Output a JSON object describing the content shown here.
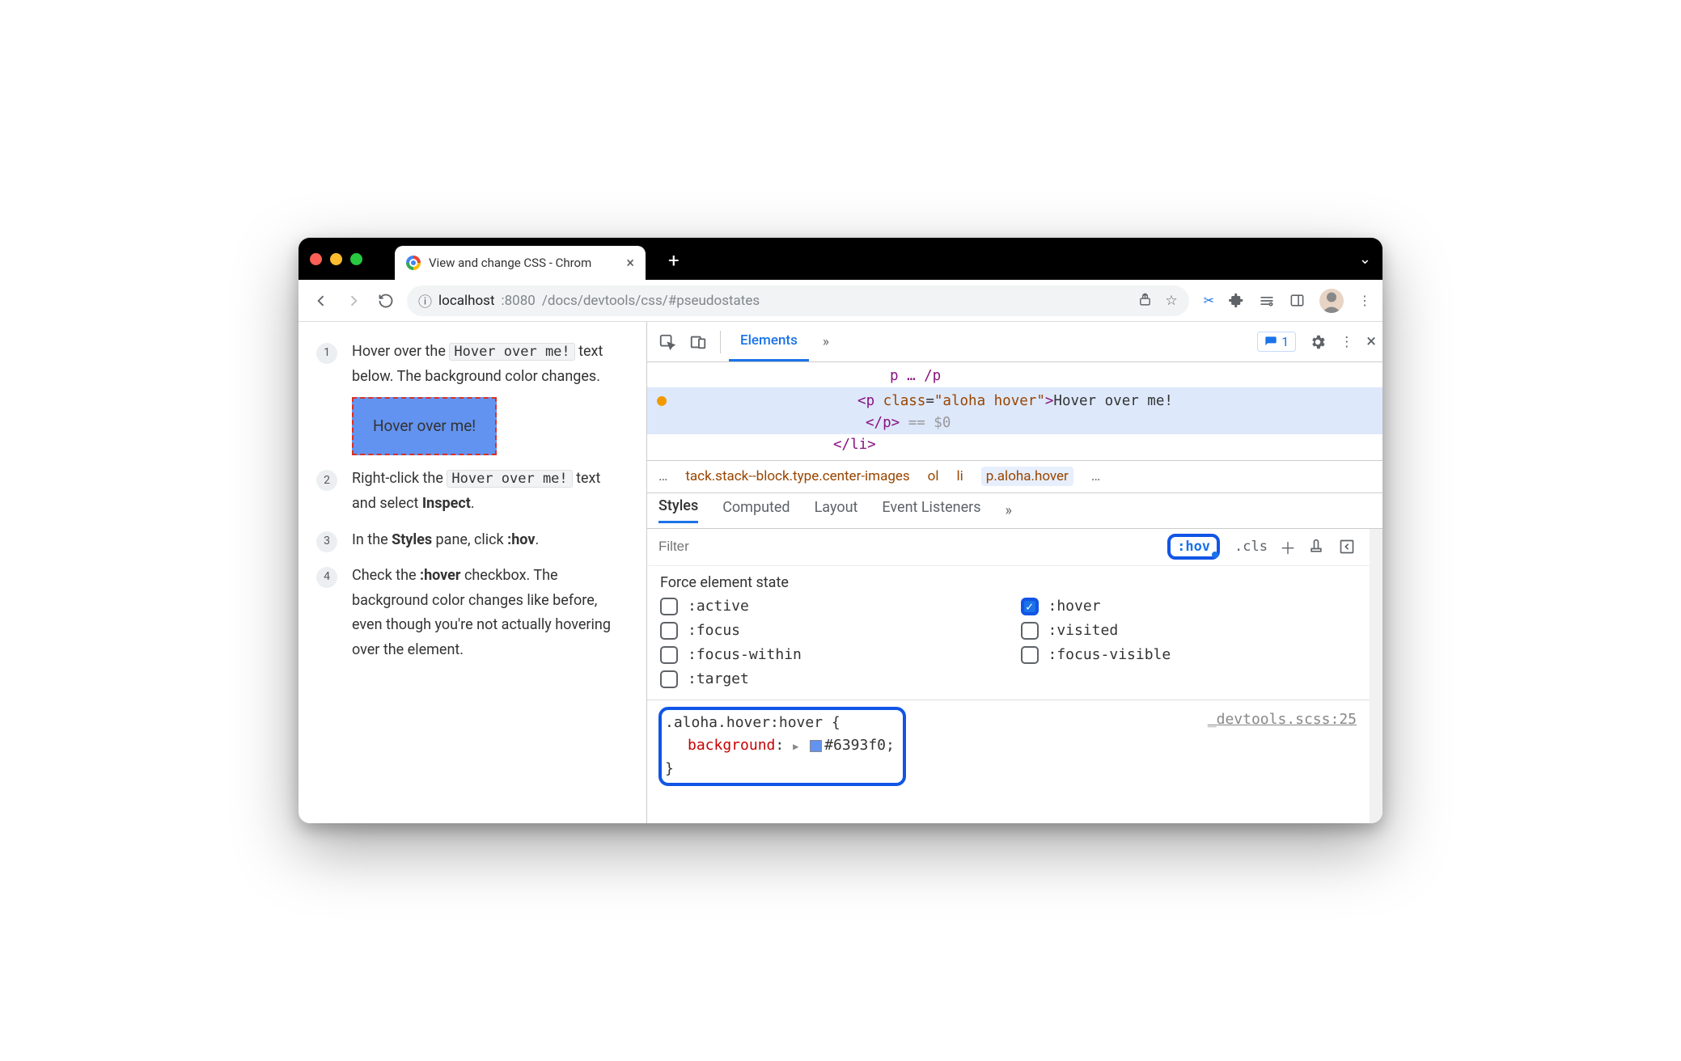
{
  "window": {
    "tab_title": "View and change CSS - Chrom",
    "url_host": "localhost",
    "url_port": ":8080",
    "url_path": "/docs/devtools/css/#pseudostates"
  },
  "page": {
    "steps": [
      {
        "n": "1",
        "pre": "Hover over the ",
        "code": "Hover over me!",
        "post": " text below. The background color changes."
      },
      {
        "n": "2",
        "pre": "Right-click the ",
        "code": "Hover over me!",
        "post": " text and select ",
        "bold": "Inspect",
        "tail": "."
      },
      {
        "n": "3",
        "pre": "In the ",
        "bold": "Styles",
        "mid": " pane, click ",
        "bold2": ":hov",
        "tail": "."
      },
      {
        "n": "4",
        "pre": "Check the ",
        "bold": ":hover",
        "post": " checkbox. The background color changes like before, even though you're not actually hovering over the element."
      }
    ],
    "hover_box": "Hover over me!"
  },
  "devtools": {
    "panel": "Elements",
    "issues_count": "1",
    "dom": {
      "line1_tag_open": "<p ",
      "line1_attr": "class",
      "line1_val": "\"aloha hover\"",
      "line1_text": "Hover over me!",
      "line2_close": "</p>",
      "eq0": "== $0"
    },
    "crumbs": {
      "ellipsis": "…",
      "c1": "tack.stack--block.type.center-images",
      "c2": "ol",
      "c3": "li",
      "c4": "p.aloha.hover"
    },
    "styles_tabs": [
      "Styles",
      "Computed",
      "Layout",
      "Event Listeners"
    ],
    "filter_placeholder": "Filter",
    "hov_label": ":hov",
    "cls_label": ".cls",
    "force_title": "Force element state",
    "states": {
      "active": ":active",
      "hover": ":hover",
      "focus": ":focus",
      "visited": ":visited",
      "focus_within": ":focus-within",
      "focus_visible": ":focus-visible",
      "target": ":target"
    },
    "rule": {
      "selector": ".aloha.hover:hover {",
      "prop": "background",
      "value": "#6393f0",
      "close": "}",
      "source": "_devtools.scss:25"
    }
  }
}
